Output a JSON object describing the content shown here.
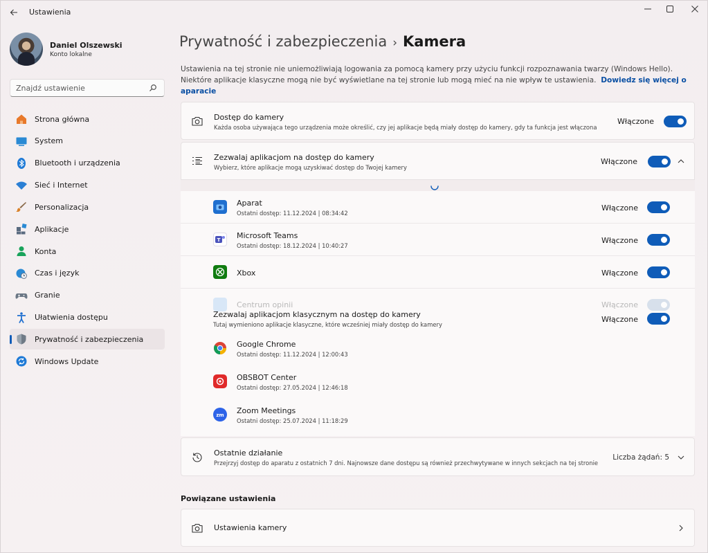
{
  "window": {
    "app_title": "Ustawienia",
    "back_icon": "arrow-left-icon",
    "controls": [
      "minimize-icon",
      "maximize-icon",
      "close-icon"
    ]
  },
  "profile": {
    "name": "Daniel Olszewski",
    "account_type": "Konto lokalne"
  },
  "search": {
    "placeholder": "Znajdź ustawienie"
  },
  "sidebar": {
    "items": [
      {
        "label": "Strona główna",
        "icon": "home-icon",
        "color": "#e8792b"
      },
      {
        "label": "System",
        "icon": "system-icon",
        "color": "#2a8ad4"
      },
      {
        "label": "Bluetooth i urządzenia",
        "icon": "bluetooth-icon",
        "color": "#1f7ad6"
      },
      {
        "label": "Sieć i Internet",
        "icon": "wifi-icon",
        "color": "#2a7fd4"
      },
      {
        "label": "Personalizacja",
        "icon": "brush-icon",
        "color": "#d9822b"
      },
      {
        "label": "Aplikacje",
        "icon": "apps-icon",
        "color": "#5a6b80"
      },
      {
        "label": "Konta",
        "icon": "account-icon",
        "color": "#19a35b"
      },
      {
        "label": "Czas i język",
        "icon": "globe-clock-icon",
        "color": "#2a8ad4"
      },
      {
        "label": "Granie",
        "icon": "gamepad-icon",
        "color": "#6b7785"
      },
      {
        "label": "Ułatwienia dostępu",
        "icon": "accessibility-icon",
        "color": "#1f6fcf"
      },
      {
        "label": "Prywatność i zabezpieczenia",
        "icon": "shield-icon",
        "color": "#6f7a86",
        "active": true
      },
      {
        "label": "Windows Update",
        "icon": "update-icon",
        "color": "#1f7ad6"
      }
    ]
  },
  "header": {
    "parent": "Prywatność i zabezpieczenia",
    "separator": "›",
    "current": "Kamera"
  },
  "intro": {
    "text": "Ustawienia na tej stronie nie uniemożliwiają logowania za pomocą kamery przy użyciu funkcji rozpoznawania twarzy (Windows Hello). Niektóre aplikacje klasyczne mogą nie być wyświetlane na tej stronie lub mogą mieć na nie wpływ te ustawienia.",
    "link": "Dowiedz się więcej o aparacie"
  },
  "camera_access": {
    "title": "Dostęp do kamery",
    "subtitle": "Każda osoba używająca tego urządzenia może określić, czy jej aplikacje będą miały dostęp do kamery, gdy ta funkcja jest włączona",
    "status": "Włączone",
    "enabled": true
  },
  "apps_access": {
    "title": "Zezwalaj aplikacjom na dostęp do kamery",
    "subtitle": "Wybierz, które aplikacje mogą uzyskiwać dostęp do Twojej kamery",
    "status": "Włączone",
    "enabled": true,
    "apps": [
      {
        "name": "Aparat",
        "meta": "Ostatni dostęp: 11.12.2024  |  08:34:42",
        "status": "Włączone",
        "icon": "camera-app-icon",
        "color": "#1f6fcf"
      },
      {
        "name": "Microsoft Teams",
        "meta": "Ostatni dostęp: 18.12.2024  |  10:40:27",
        "status": "Włączone",
        "icon": "teams-icon",
        "color": "#4b53bc"
      },
      {
        "name": "Xbox",
        "meta": "",
        "status": "Włączone",
        "icon": "xbox-icon",
        "color": "#107c10"
      },
      {
        "name": "Centrum opinii",
        "meta": "",
        "status": "Włączone",
        "icon": "feedback-hub-icon",
        "color": "#3a8ee6"
      }
    ]
  },
  "desktop_apps": {
    "title": "Zezwalaj aplikacjom klasycznym na dostęp do kamery",
    "subtitle": "Tutaj wymieniono aplikacje klasyczne, które wcześniej miały dostęp do kamery",
    "status": "Włączone",
    "enabled": true,
    "apps": [
      {
        "name": "Google Chrome",
        "meta": "Ostatni dostęp: 11.12.2024  |  12:00:43",
        "icon": "chrome-icon"
      },
      {
        "name": "OBSBOT Center",
        "meta": "Ostatni dostęp: 27.05.2024  |  12:46:18",
        "icon": "obsbot-icon"
      },
      {
        "name": "Zoom Meetings",
        "meta": "Ostatni dostęp: 25.07.2024  |  11:18:29",
        "icon": "zoom-icon"
      }
    ]
  },
  "recent": {
    "title": "Ostatnie działanie",
    "subtitle": "Przejrzyj dostęp do aparatu z ostatnich 7 dni. Najnowsze dane dostępu są również przechwytywane w innych sekcjach na tej stronie",
    "count_label": "Liczba żądań: 5"
  },
  "related": {
    "section_title": "Powiązane ustawienia",
    "camera_settings": "Ustawienia kamery"
  },
  "colors": {
    "accent": "#0f5cb8"
  }
}
